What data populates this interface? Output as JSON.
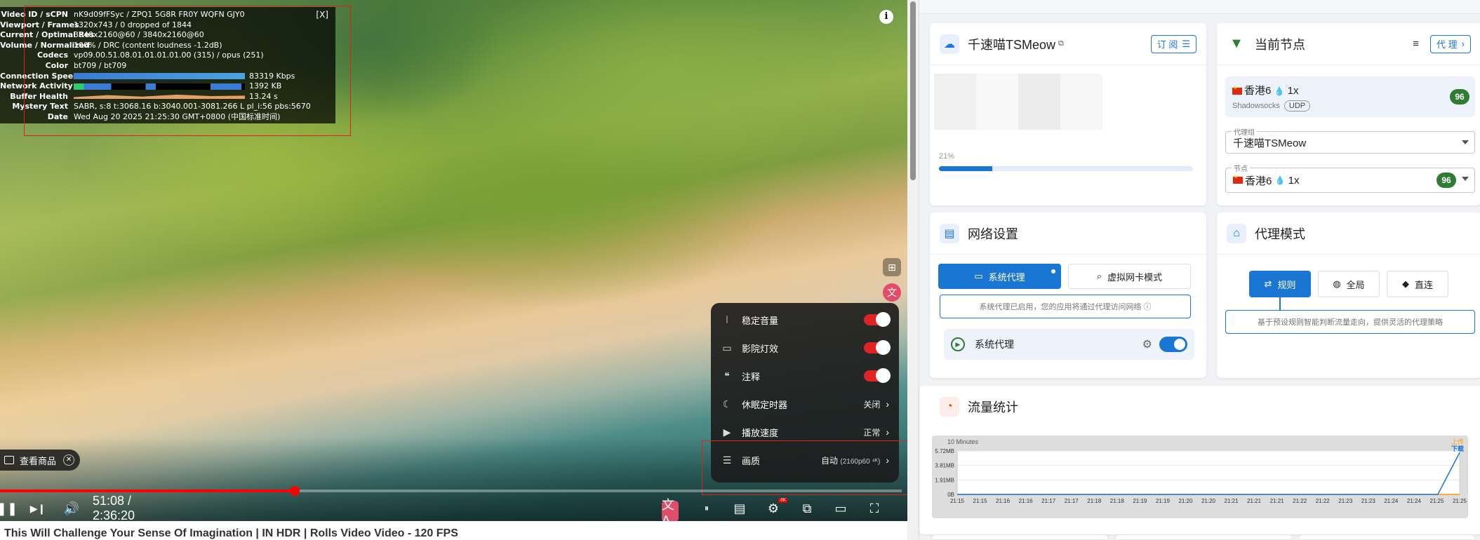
{
  "video": {
    "stats_for_nerds": {
      "close": "[X]",
      "rows": [
        {
          "k": "Video ID / sCPN",
          "v": "nK9d09fFSyc  /  ZPQ1  5G8R  FR0Y  WQFN  GJY0"
        },
        {
          "k": "Viewport / Frames",
          "v": "1320x743 / 0 dropped of 1844"
        },
        {
          "k": "Current / Optimal Res",
          "v": "3840x2160@60 / 3840x2160@60"
        },
        {
          "k": "Volume / Normalized",
          "v": "100% / DRC (content loudness -1.2dB)"
        },
        {
          "k": "Codecs",
          "v": "vp09.00.51.08.01.01.01.01.00 (315) / opus (251)"
        },
        {
          "k": "Color",
          "v": "bt709 / bt709"
        },
        {
          "k": "Connection Speed",
          "v": "83319 Kbps",
          "bar": "conn"
        },
        {
          "k": "Network Activity",
          "v": "1392 KB",
          "bar": "net"
        },
        {
          "k": "Buffer Health",
          "v": "13.24 s",
          "bar": "buf"
        },
        {
          "k": "Mystery Text",
          "v": "SABR, s:8 t:3068.16 b:3040.001-3081.266 L pl_i:56 pbs:5670"
        },
        {
          "k": "Date",
          "v": "Wed Aug 20 2025 21:25:30 GMT+0800 (中国标准时间)"
        }
      ]
    },
    "info_icon": "i",
    "settings_menu": {
      "items": [
        {
          "icon": "stable-volume-icon",
          "glyph": "⦚",
          "label": "稳定音量",
          "toggle": true
        },
        {
          "icon": "ambient-mode-icon",
          "glyph": "▭",
          "label": "影院灯效",
          "toggle": true
        },
        {
          "icon": "annotations-icon",
          "glyph": "❝",
          "label": "注释",
          "toggle": true
        },
        {
          "icon": "sleep-timer-icon",
          "glyph": "☾",
          "label": "休眠定时器",
          "value": "关闭"
        },
        {
          "icon": "playback-speed-icon",
          "glyph": "▶",
          "label": "播放速度",
          "value": "正常"
        },
        {
          "icon": "quality-icon",
          "glyph": "☰",
          "label": "画质",
          "value": "自动",
          "value_sub": "(2160p60 ⁴ᴷ)"
        }
      ]
    },
    "shopping_chip": {
      "label": "查看商品",
      "close": "✕"
    },
    "progress": {
      "played_fraction": 0.3265,
      "color": "#ff0000"
    },
    "controls": {
      "pause": "❚❚",
      "next": "▶❙",
      "volume": "🔊",
      "time": "51:08 / 2:36:20",
      "ai_translate": "文A",
      "autoplay": "⏸",
      "subtitles": "▤",
      "settings": "⚙",
      "settings_badge": "4K",
      "miniplayer": "⧉",
      "theater": "▭",
      "fullscreen": "⛶"
    },
    "below_title": "This Will Challenge Your Sense Of Imagination | IN HDR | Rolls Video Video - 120 FPS"
  },
  "panel": {
    "subscription": {
      "name": "千速喵TSMeow",
      "link_icon": "⧉",
      "button": "订 阅",
      "progress_label": "21%",
      "progress_fraction": 0.21
    },
    "current_node": {
      "title": "当前节点",
      "proxy_button": "代 理",
      "node_name": "香港6",
      "node_multiplier": "1x",
      "protocol": "Shadowsocks",
      "transport": "UDP",
      "delay": "96",
      "group_label": "代理组",
      "group_value": "千速喵TSMeow",
      "node_label": "节点",
      "node_value_name": "香港6",
      "node_value_mult": "1x",
      "node_delay": "96"
    },
    "network": {
      "title": "网络设置",
      "system_proxy_tab": "系统代理",
      "tun_tab": "虚拟网卡模式",
      "hint": "系统代理已启用，您的应用将通过代理访问网络",
      "row_label": "系统代理"
    },
    "proxy_mode": {
      "title": "代理模式",
      "rule": "规则",
      "global": "全局",
      "direct": "直连",
      "hint": "基于预设规则智能判断流量走向，提供灵活的代理策略"
    },
    "traffic": {
      "title": "流量统计"
    }
  },
  "chart_data": {
    "type": "line",
    "title": "10 Minutes",
    "legend": [
      "上传",
      "下载"
    ],
    "legend_colors": [
      "#ff9800",
      "#1976d2"
    ],
    "legend_position": "top-right",
    "y_ticks": [
      "5.72MB",
      "3.81MB",
      "1.91MB",
      "0B"
    ],
    "ylim": [
      0,
      5.72
    ],
    "x_ticks": [
      "21:15",
      "21:15",
      "21:16",
      "21:16",
      "21:17",
      "21:17",
      "21:18",
      "21:18",
      "21:19",
      "21:19",
      "21:20",
      "21:20",
      "21:21",
      "21:21",
      "21:21",
      "21:22",
      "21:22",
      "21:23",
      "21:23",
      "21:24",
      "21:24",
      "21:25",
      "21:25"
    ],
    "series": [
      {
        "name": "上传",
        "values": [
          0,
          0,
          0,
          0,
          0,
          0,
          0,
          0,
          0,
          0,
          0,
          0,
          0,
          0,
          0,
          0,
          0,
          0,
          0,
          0,
          0,
          0,
          0,
          0
        ]
      },
      {
        "name": "下载",
        "values": [
          0,
          0,
          0,
          0,
          0,
          0,
          0,
          0,
          0,
          0,
          0,
          0,
          0,
          0,
          0,
          0,
          0,
          0,
          0,
          0,
          0,
          0,
          0,
          5.5
        ]
      }
    ],
    "grid": true
  }
}
